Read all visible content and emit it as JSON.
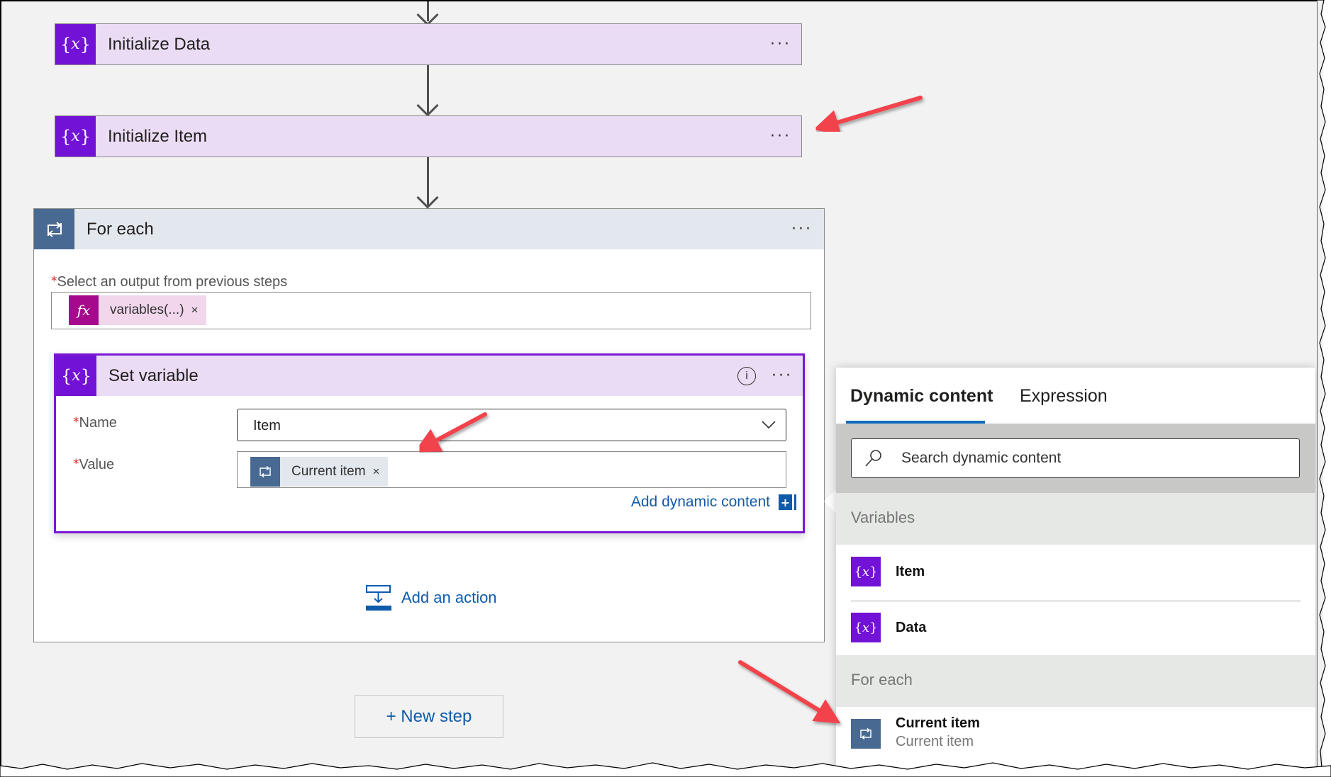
{
  "flow": {
    "steps": [
      {
        "title": "Initialize Data",
        "icon": "variable-icon",
        "menu": "···"
      },
      {
        "title": "Initialize Item",
        "icon": "variable-icon",
        "menu": "···"
      }
    ],
    "foreach": {
      "title": "For each",
      "menu": "···",
      "output_label": "Select an output from previous steps",
      "output_token": {
        "label": "variables(...)",
        "icon_text": "fx",
        "remove": "×"
      },
      "set_variable": {
        "title": "Set variable",
        "menu": "···",
        "info": "i",
        "name_label": "Name",
        "name_value": "Item",
        "value_label": "Value",
        "value_token": {
          "label": "Current item",
          "remove": "×"
        },
        "add_dynamic": "Add dynamic content",
        "add_dynamic_icon": "+"
      },
      "add_action": "Add an action"
    },
    "new_step": "+ New step",
    "required_mark": "*"
  },
  "panel": {
    "tabs": [
      {
        "label": "Dynamic content",
        "active": true
      },
      {
        "label": "Expression",
        "active": false
      }
    ],
    "search_placeholder": "Search dynamic content",
    "sections": [
      {
        "header": "Variables",
        "items": [
          {
            "title": "Item",
            "icon": "variable-icon"
          },
          {
            "title": "Data",
            "icon": "variable-icon"
          }
        ]
      },
      {
        "header": "For each",
        "items": [
          {
            "title": "Current item",
            "subtitle": "Current item",
            "icon": "loop-icon"
          }
        ]
      }
    ]
  },
  "colors": {
    "variable_purple": "#7212d6",
    "card_lavender": "#ebdcf5",
    "loop_blue": "#486991",
    "expression_magenta": "#a6098c",
    "link_blue": "#0f5bab",
    "tab_underline": "#0f6cbd",
    "annotation_red": "#f2434b"
  }
}
